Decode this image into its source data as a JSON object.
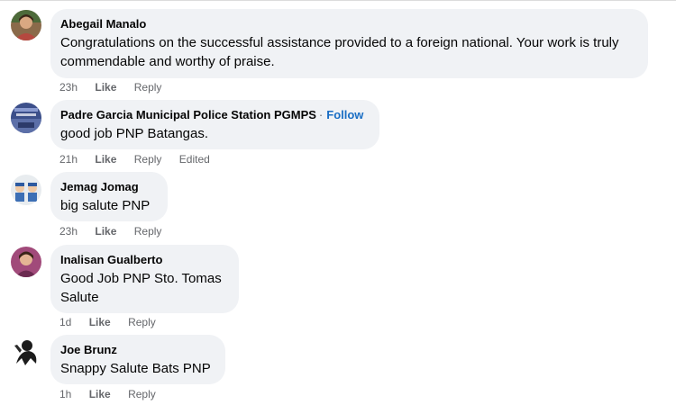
{
  "comments": [
    {
      "author": "Abegail Manalo",
      "follow": "",
      "text": "Congratulations on the successful assistance provided to a foreign national. Your work is truly commendable and worthy of praise.",
      "time": "23h",
      "like": "Like",
      "reply": "Reply",
      "edited": ""
    },
    {
      "author": "Padre Garcia Municipal Police Station PGMPS",
      "follow": "Follow",
      "text": "good job PNP Batangas.",
      "time": "21h",
      "like": "Like",
      "reply": "Reply",
      "edited": "Edited"
    },
    {
      "author": "Jemag Jomag",
      "follow": "",
      "text": "big salute PNP",
      "time": "23h",
      "like": "Like",
      "reply": "Reply",
      "edited": ""
    },
    {
      "author": "Inalisan Gualberto",
      "follow": "",
      "text": "Good Job PNP Sto. Tomas Salute",
      "time": "1d",
      "like": "Like",
      "reply": "Reply",
      "edited": ""
    },
    {
      "author": "Joe Brunz",
      "follow": "",
      "text": "Snappy Salute Bats PNP",
      "time": "1h",
      "like": "Like",
      "reply": "Reply",
      "edited": ""
    }
  ],
  "separator": "·",
  "colors": {
    "bubble": "#f0f2f5",
    "link": "#1a6ec4",
    "meta": "#65676b",
    "text": "#050505"
  }
}
